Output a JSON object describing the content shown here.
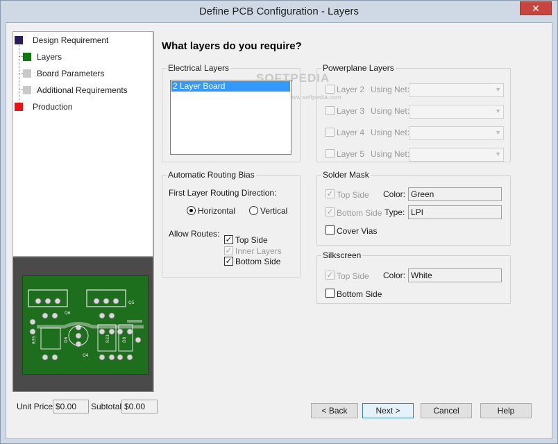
{
  "window": {
    "title": "Define PCB Configuration - Layers",
    "close_symbol": "✕"
  },
  "steps": [
    {
      "label": "Design Requirement",
      "color": "#2a1a5e"
    },
    {
      "label": "Layers",
      "color": "#0e7a0e"
    },
    {
      "label": "Board Parameters",
      "color": "#c8c8c8"
    },
    {
      "label": "Additional Requirements",
      "color": "#c8c8c8"
    },
    {
      "label": "Production",
      "color": "#ee1111"
    }
  ],
  "pcb_labels": {
    "q6": "Q6",
    "q5": "Q5",
    "r35": "R35",
    "q4": "Q4",
    "r33": "R33",
    "d8": "D8",
    "d6": "D6"
  },
  "heading": "What layers do you require?",
  "electrical": {
    "legend": "Electrical Layers",
    "items": [
      "2 Layer Board"
    ]
  },
  "powerplane": {
    "legend": "Powerplane Layers",
    "using_net_label": "Using Net:",
    "layers": [
      "Layer 2",
      "Layer 3",
      "Layer 4",
      "Layer 5"
    ]
  },
  "routing": {
    "legend": "Automatic Routing Bias",
    "direction_label": "First Layer Routing Direction:",
    "horizontal": "Horizontal",
    "vertical": "Vertical",
    "allow_label": "Allow Routes:",
    "top_side": "Top Side",
    "inner_layers": "Inner Layers",
    "bottom_side": "Bottom Side"
  },
  "solder_mask": {
    "legend": "Solder Mask",
    "top_side": "Top Side",
    "bottom_side": "Bottom Side",
    "cover_vias": "Cover Vias",
    "color_label": "Color:",
    "color_value": "Green",
    "type_label": "Type:",
    "type_value": "LPI"
  },
  "silkscreen": {
    "legend": "Silkscreen",
    "top_side": "Top Side",
    "bottom_side": "Bottom Side",
    "color_label": "Color:",
    "color_value": "White"
  },
  "footer": {
    "unit_price_label": "Unit Price:",
    "unit_price_value": "$0.00",
    "subtotal_label": "Subtotal:",
    "subtotal_value": "$0.00",
    "back": "< Back",
    "next": "Next >",
    "cancel": "Cancel",
    "help": "Help"
  },
  "watermark": {
    "main": "SOFTPEDIA",
    "sub": "www.softpedia.com"
  }
}
